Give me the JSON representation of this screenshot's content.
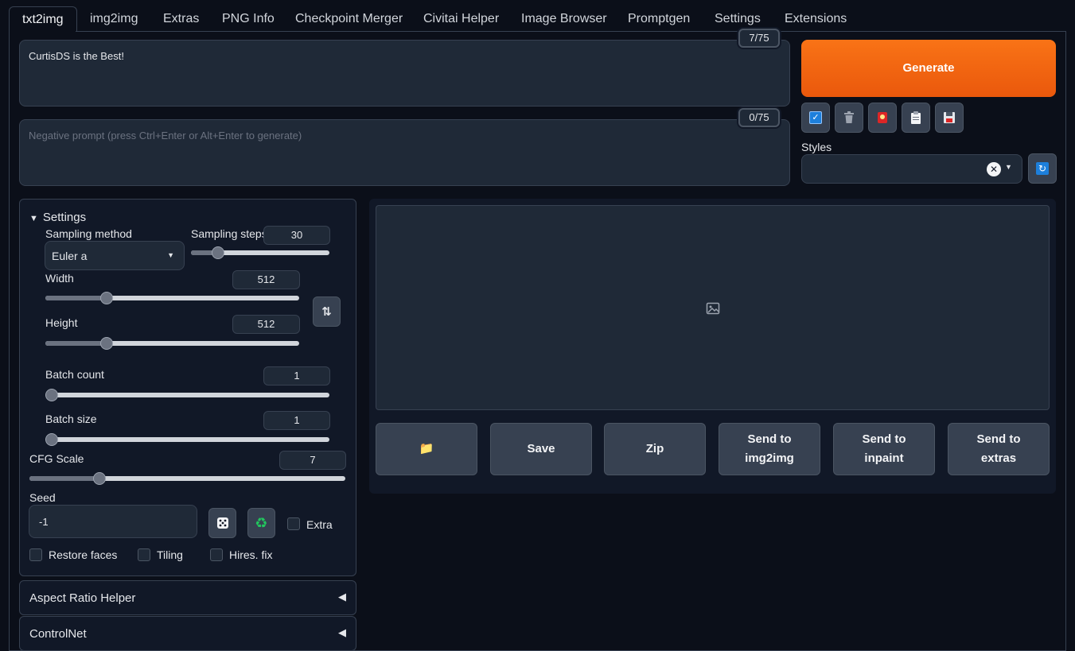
{
  "tabs": [
    "txt2img",
    "img2img",
    "Extras",
    "PNG Info",
    "Checkpoint Merger",
    "Civitai Helper",
    "Image Browser",
    "Promptgen",
    "Settings",
    "Extensions"
  ],
  "prompt": {
    "value": "CurtisDS is the Best!",
    "counter": "7/75"
  },
  "negative_prompt": {
    "placeholder": "Negative prompt (press Ctrl+Enter or Alt+Enter to generate)",
    "counter": "0/75"
  },
  "generate_label": "Generate",
  "styles_label": "Styles",
  "settings": {
    "title": "Settings",
    "sampling_method_label": "Sampling method",
    "sampling_method_value": "Euler a",
    "sampling_steps_label": "Sampling steps",
    "sampling_steps_value": "30",
    "width_label": "Width",
    "width_value": "512",
    "height_label": "Height",
    "height_value": "512",
    "batch_count_label": "Batch count",
    "batch_count_value": "1",
    "batch_size_label": "Batch size",
    "batch_size_value": "1",
    "cfg_label": "CFG Scale",
    "cfg_value": "7",
    "seed_label": "Seed",
    "seed_value": "-1",
    "extra_label": "Extra",
    "restore_faces_label": "Restore faces",
    "tiling_label": "Tiling",
    "hires_label": "Hires. fix"
  },
  "output_buttons": {
    "folder": "📁",
    "save": "Save",
    "zip": "Zip",
    "send_img2img": "Send to img2img",
    "send_inpaint": "Send to inpaint",
    "send_extras": "Send to extras"
  },
  "accordions": {
    "aspect_ratio": "Aspect Ratio Helper",
    "controlnet": "ControlNet"
  },
  "colors": {
    "accent": "#f97316",
    "background": "#0b0f19",
    "panel": "#1f2937"
  }
}
